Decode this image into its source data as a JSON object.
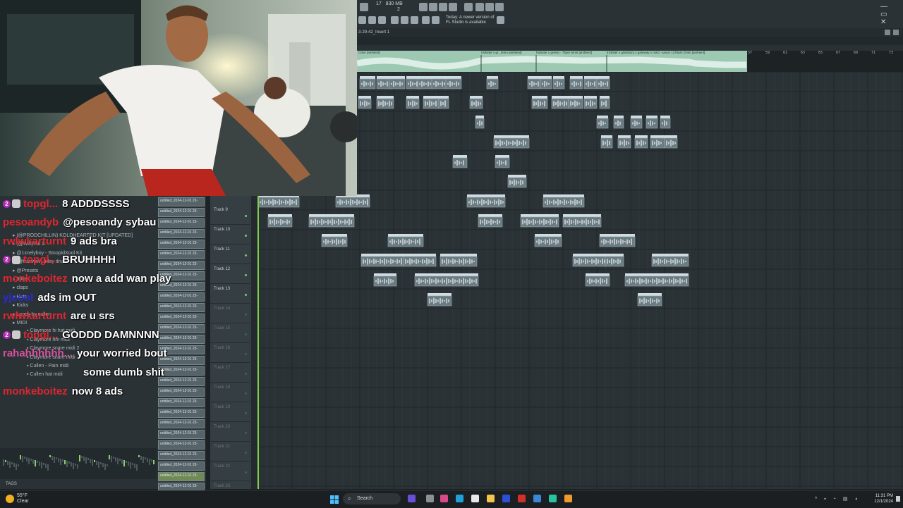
{
  "toolbar": {
    "cpu_label": "17",
    "memory_label": "830 MB",
    "voices_label": "2",
    "update_notice": [
      "Today: A newer version of",
      "FL Studio is available"
    ],
    "window_controls": "— ▭ ✕"
  },
  "playlist": {
    "title": "3-29-42_Insert 1",
    "ruler_ticks": [
      "13",
      "15",
      "17",
      "19",
      "21",
      "23",
      "25",
      "27",
      "29",
      "31",
      "33",
      "35",
      "37",
      "39",
      "41",
      "43",
      "45",
      "47",
      "49",
      "51",
      "53",
      "55",
      "57",
      "59",
      "61",
      "63",
      "65",
      "67",
      "69",
      "71",
      "73"
    ],
    "audio_clip_labels": [
      "Gmin [ambient]",
      "trickster x gr...bmin [ambient]",
      "trickster x griedo - 7bpm 6min [ambient]",
      "trickster x griedrazy x gateway x marz - jaxon 137bpm Gmin [ambient]"
    ],
    "tracks": [
      {
        "label": "Track 9",
        "active": true
      },
      {
        "label": "Track 10",
        "active": true
      },
      {
        "label": "Track 11",
        "active": true
      },
      {
        "label": "Track 12",
        "active": true
      },
      {
        "label": "Track 13",
        "active": true
      },
      {
        "label": "Track 14",
        "active": false
      },
      {
        "label": "Track 15",
        "active": false
      },
      {
        "label": "Track 16",
        "active": false
      },
      {
        "label": "Track 17",
        "active": false
      },
      {
        "label": "Track 18",
        "active": false
      },
      {
        "label": "Track 19",
        "active": false
      },
      {
        "label": "Track 20",
        "active": false
      },
      {
        "label": "Track 21",
        "active": false
      },
      {
        "label": "Track 22",
        "active": false
      },
      {
        "label": "Track 23",
        "active": false
      }
    ],
    "pattern_label": "untitled_2024-12-01 23-"
  },
  "browser": {
    "items": [
      "(@PRODCHILLIN) KOLDHEARTED KIT [UPDATED]",
      "(@Wifi) Kit 1",
      "@1xnelyboy - StoopidXool Kit",
      "(@franwav) bday drum kit",
      "@Presets",
      "808s",
      "claps",
      "Hats",
      "Kicks",
      "Loops by cullen",
      "MIDI",
      "Claymore hi hat midi",
      "Claymore rim midi",
      "Claymore snare midi 2",
      "Claymore snare midi",
      "Cullen - Pain midi",
      "Cullen hat midi"
    ],
    "tags_label": "TAGS"
  },
  "chat": [
    {
      "user": "topgl...",
      "color": "#e0262e",
      "msg": "8 ADDDSSSS",
      "badge": "2"
    },
    {
      "user": "pesoandyb",
      "color": "#e0262e",
      "msg": "@pesoandy sybau",
      "badge": ""
    },
    {
      "user": "rwlwkarturnt",
      "color": "#e0262e",
      "msg": "9 ads bra",
      "badge": ""
    },
    {
      "user": "topgl...",
      "color": "#e0262e",
      "msg": "BRUHHHH",
      "badge": "2"
    },
    {
      "user": "monkeboitez",
      "color": "#e0262e",
      "msg": "now a add wan play",
      "badge": ""
    },
    {
      "user": "yjcool",
      "color": "#2a2ad6",
      "msg": "ads im OUT",
      "badge": ""
    },
    {
      "user": "rwlwkarturnt",
      "color": "#e0262e",
      "msg": "are u srs",
      "badge": ""
    },
    {
      "user": "topgl...",
      "color": "#e0262e",
      "msg": "GODDD DAMNNNN",
      "badge": "2"
    },
    {
      "user": "rahahhhhhh...",
      "color": "#d9509c",
      "msg": "your worried bout",
      "badge": ""
    },
    {
      "user": "",
      "color": "#ffffff",
      "msg": "some dumb shit",
      "badge": ""
    },
    {
      "user": "monkeboitez",
      "color": "#e0262e",
      "msg": "now 8 ads",
      "badge": ""
    }
  ],
  "taskbar": {
    "weather_temp": "55°F",
    "weather_desc": "Clear",
    "search_label": "Search",
    "time": "11:31 PM",
    "date": "12/1/2024"
  }
}
